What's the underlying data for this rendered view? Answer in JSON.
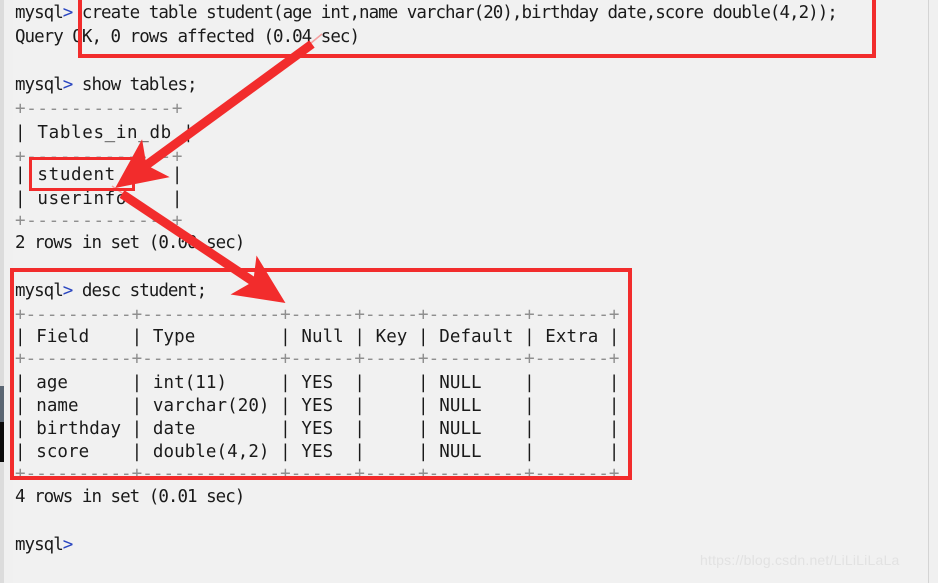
{
  "window": {
    "kind": "mysql-command-line-terminal",
    "background_color": "#f1f1f1",
    "text_color": "#1a1a1a"
  },
  "terminal": {
    "prompt": "mysql>",
    "lines": [
      {
        "id": "l01",
        "text": "mysql> create table student(age int,name varchar(20),birthday date,score double(4,2));"
      },
      {
        "id": "l02",
        "text": "Query OK, 0 rows affected (0.04 sec)"
      },
      {
        "id": "l03",
        "text": ""
      },
      {
        "id": "l04",
        "text": "mysql> show tables;"
      },
      {
        "id": "l05",
        "text": "+-------------+"
      },
      {
        "id": "l06",
        "text": "| Tables_in_db |"
      },
      {
        "id": "l07",
        "text": "+-------------+"
      },
      {
        "id": "l08",
        "text": "| student     |"
      },
      {
        "id": "l09",
        "text": "| userinfo    |"
      },
      {
        "id": "l10",
        "text": "+-------------+"
      },
      {
        "id": "l11",
        "text": "2 rows in set (0.00 sec)"
      },
      {
        "id": "l12",
        "text": ""
      },
      {
        "id": "l13",
        "text": "mysql> desc student;"
      },
      {
        "id": "l14",
        "text": "+----------+-------------+------+-----+---------+-------+"
      },
      {
        "id": "l15",
        "text": "| Field    | Type        | Null | Key | Default | Extra |"
      },
      {
        "id": "l16",
        "text": "+----------+-------------+------+-----+---------+-------+"
      },
      {
        "id": "l17",
        "text": "| age      | int(11)     | YES  |     | NULL    |       |"
      },
      {
        "id": "l18",
        "text": "| name     | varchar(20) | YES  |     | NULL    |       |"
      },
      {
        "id": "l19",
        "text": "| birthday | date        | YES  |     | NULL    |       |"
      },
      {
        "id": "l20",
        "text": "| score    | double(4,2) | YES  |     | NULL    |       |"
      },
      {
        "id": "l21",
        "text": "+----------+-------------+------+-----+---------+-------+"
      },
      {
        "id": "l22",
        "text": "4 rows in set (0.01 sec)"
      },
      {
        "id": "l23",
        "text": ""
      },
      {
        "id": "l24",
        "text": "mysql>"
      }
    ]
  },
  "statements": {
    "create_table": "create table student(age int,name varchar(20),birthday date,score double(4,2));",
    "create_result": "Query OK, 0 rows affected (0.04 sec)",
    "show_tables": "show tables;",
    "show_tables_result": "2 rows in set (0.00 sec)",
    "desc_student": "desc student;",
    "desc_result": "4 rows in set (0.01 sec)"
  },
  "show_tables_table": {
    "header": "Tables_in_db",
    "rows": [
      "student",
      "userinfo"
    ],
    "row_count_text": "2 rows in set (0.00 sec)"
  },
  "desc_table": {
    "columns": [
      "Field",
      "Type",
      "Null",
      "Key",
      "Default",
      "Extra"
    ],
    "rows": [
      {
        "Field": "age",
        "Type": "int(11)",
        "Null": "YES",
        "Key": "",
        "Default": "NULL",
        "Extra": ""
      },
      {
        "Field": "name",
        "Type": "varchar(20)",
        "Null": "YES",
        "Key": "",
        "Default": "NULL",
        "Extra": ""
      },
      {
        "Field": "birthday",
        "Type": "date",
        "Null": "YES",
        "Key": "",
        "Default": "NULL",
        "Extra": ""
      },
      {
        "Field": "score",
        "Type": "double(4,2)",
        "Null": "YES",
        "Key": "",
        "Default": "NULL",
        "Extra": ""
      }
    ],
    "row_count_text": "4 rows in set (0.01 sec)"
  },
  "annotations": {
    "color": "#f22c2c",
    "boxes": [
      {
        "id": "create-statement-box",
        "label": "create table statement highlight"
      },
      {
        "id": "student-row-box",
        "label": "student table row highlight"
      },
      {
        "id": "desc-output-box",
        "label": "desc student output highlight"
      }
    ],
    "arrows": [
      {
        "id": "arrow-create-to-student",
        "from": "create table statement",
        "to": "student row in show tables"
      },
      {
        "id": "arrow-student-to-desc",
        "from": "student row in show tables",
        "to": "desc student output"
      }
    ]
  },
  "watermark": {
    "text": "https://blog.csdn.net/LiLiLiLaLa",
    "color": "#e2e2e2"
  }
}
